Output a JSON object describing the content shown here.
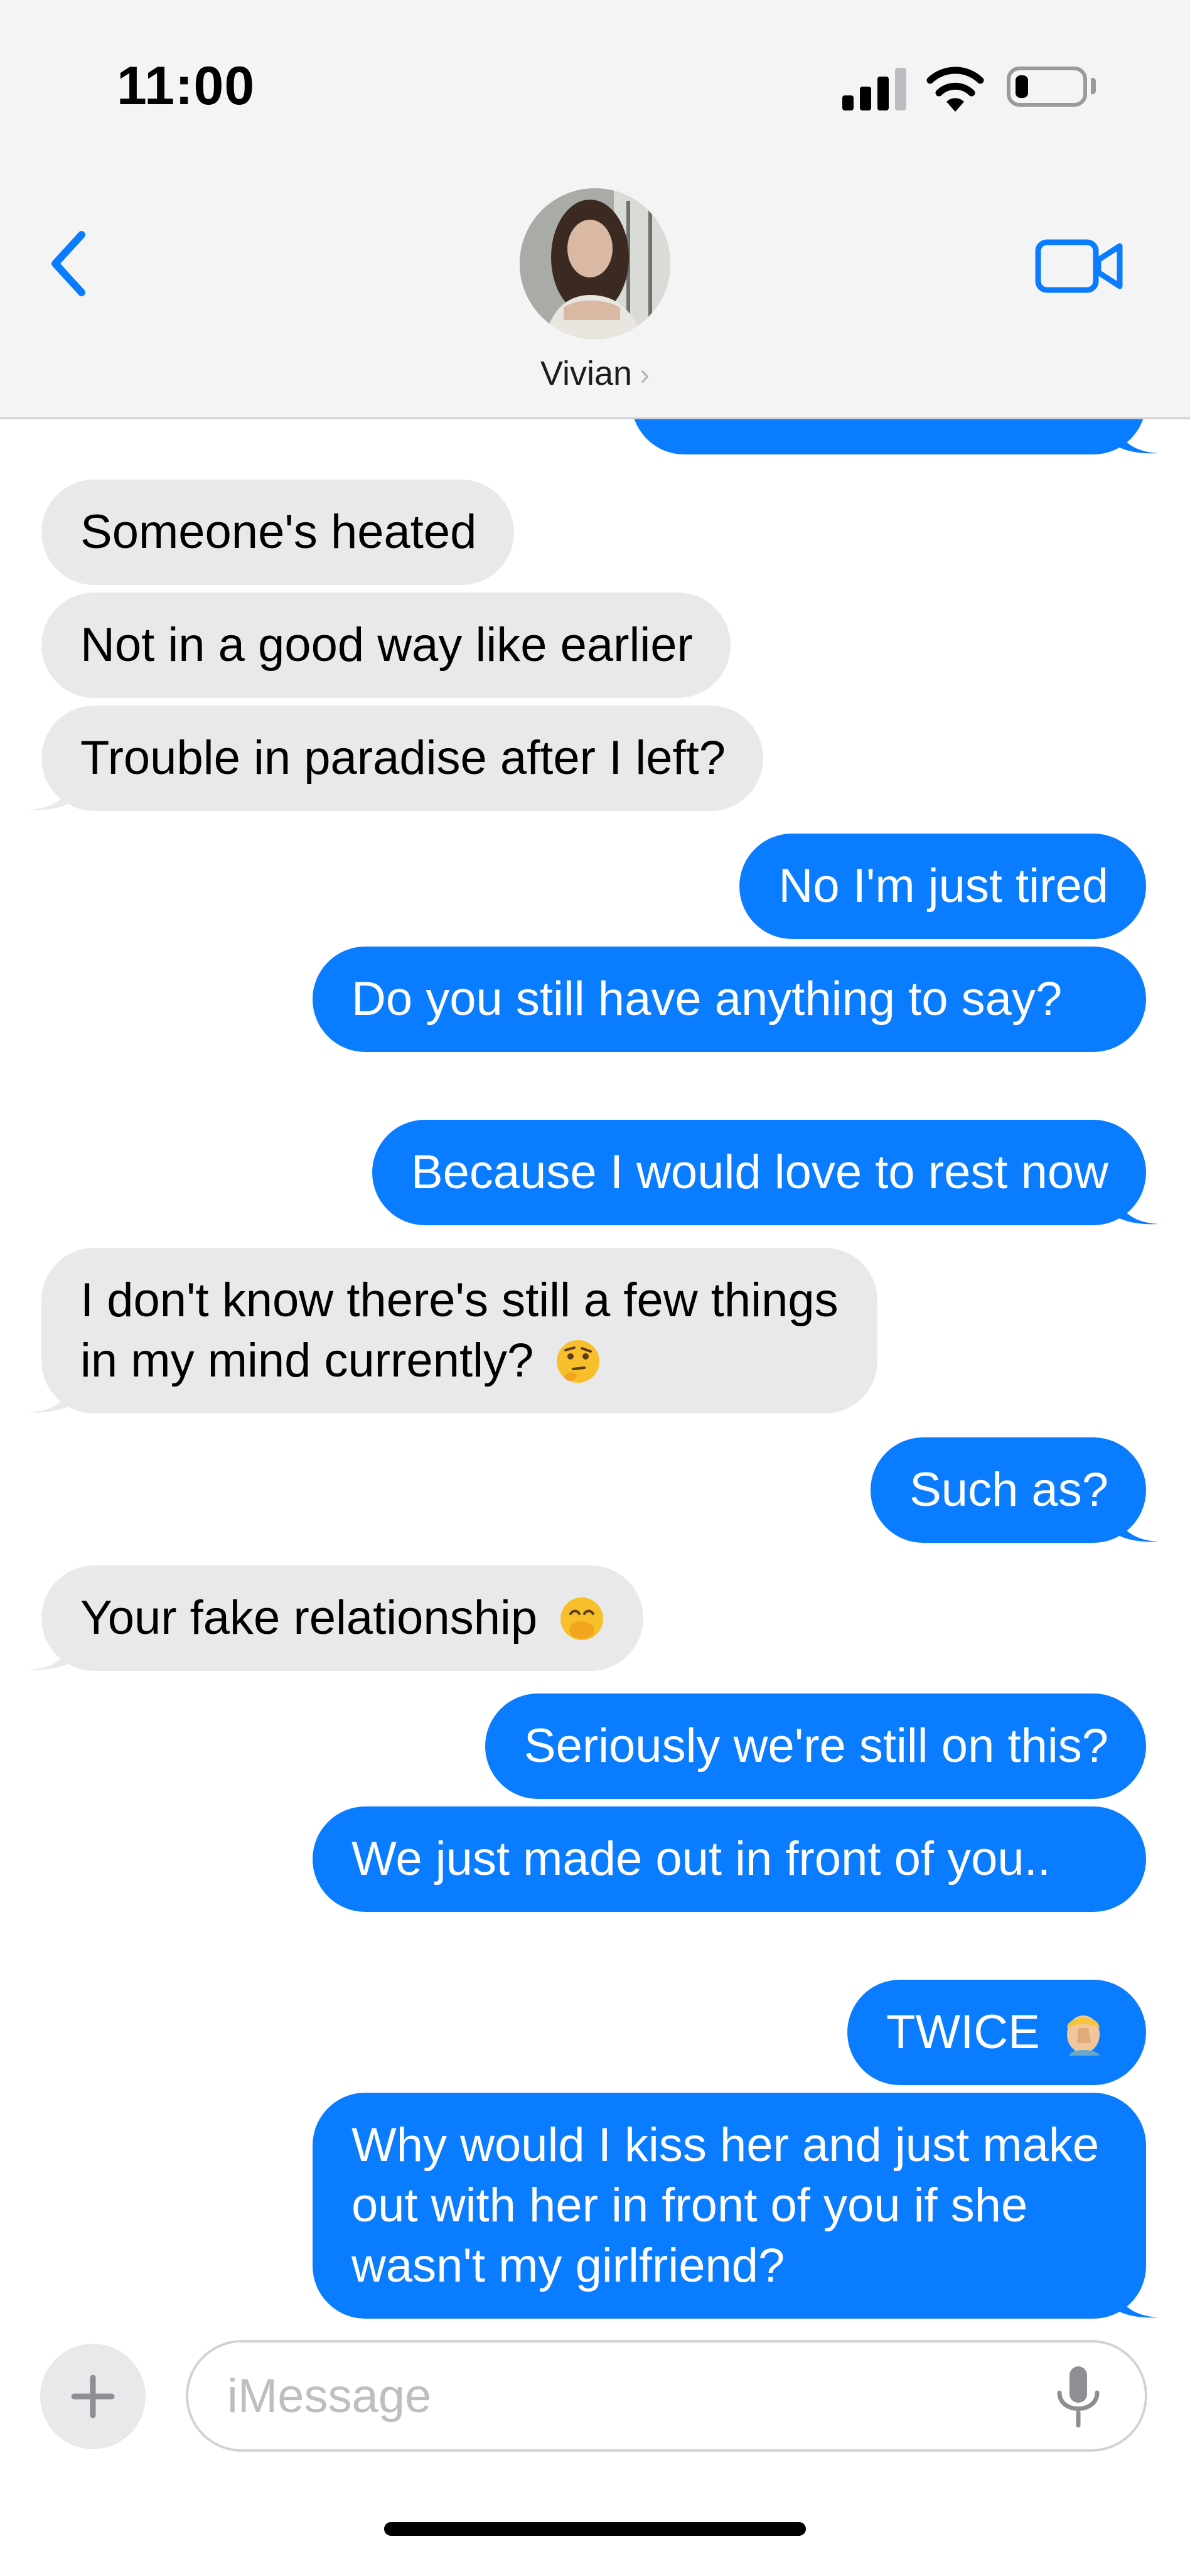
{
  "status_bar": {
    "time": "11:00",
    "signal_icon": "cellular-signal-icon",
    "wifi_icon": "wifi-icon",
    "battery_icon": "battery-icon",
    "battery_level": 0.2
  },
  "header": {
    "back_icon": "chevron-left-icon",
    "contact_name": "Vivian",
    "contact_chevron": "›",
    "facetime_icon": "video-camera-icon"
  },
  "messages": [
    {
      "direction": "outgoing",
      "text": ""
    },
    {
      "direction": "incoming",
      "text": "Someone's heated"
    },
    {
      "direction": "incoming",
      "text": "Not in a good way like earlier"
    },
    {
      "direction": "incoming",
      "text": "Trouble in paradise after I left?"
    },
    {
      "direction": "outgoing",
      "text": "No I'm just tired"
    },
    {
      "direction": "outgoing",
      "text": "Do you still have anything to say?"
    },
    {
      "direction": "outgoing",
      "text": "Because I would love to rest now"
    },
    {
      "direction": "incoming",
      "text": "I don't know there's still a few things in my mind currently?",
      "emoji": "thinking-face-emoji"
    },
    {
      "direction": "outgoing",
      "text": "Such as?"
    },
    {
      "direction": "incoming",
      "text": "Your fake relationship",
      "emoji": "face-with-hand-over-mouth-emoji"
    },
    {
      "direction": "outgoing",
      "text": "Seriously we're still on this?"
    },
    {
      "direction": "outgoing",
      "text": "We just made out in front of you.."
    },
    {
      "direction": "outgoing",
      "text": "TWICE",
      "emoji": "person-facepalming-emoji"
    },
    {
      "direction": "outgoing",
      "text": "Why would I kiss her and just make out with her in front of you if she wasn't my girlfriend?"
    }
  ],
  "input_bar": {
    "plus_icon": "plus-icon",
    "placeholder": "iMessage",
    "value": "",
    "mic_icon": "microphone-icon"
  },
  "colors": {
    "outgoing_bubble": "#0a7cff",
    "incoming_bubble": "#e9e9eb",
    "accent": "#0a7cff",
    "header_bg": "#f4f4f4"
  }
}
